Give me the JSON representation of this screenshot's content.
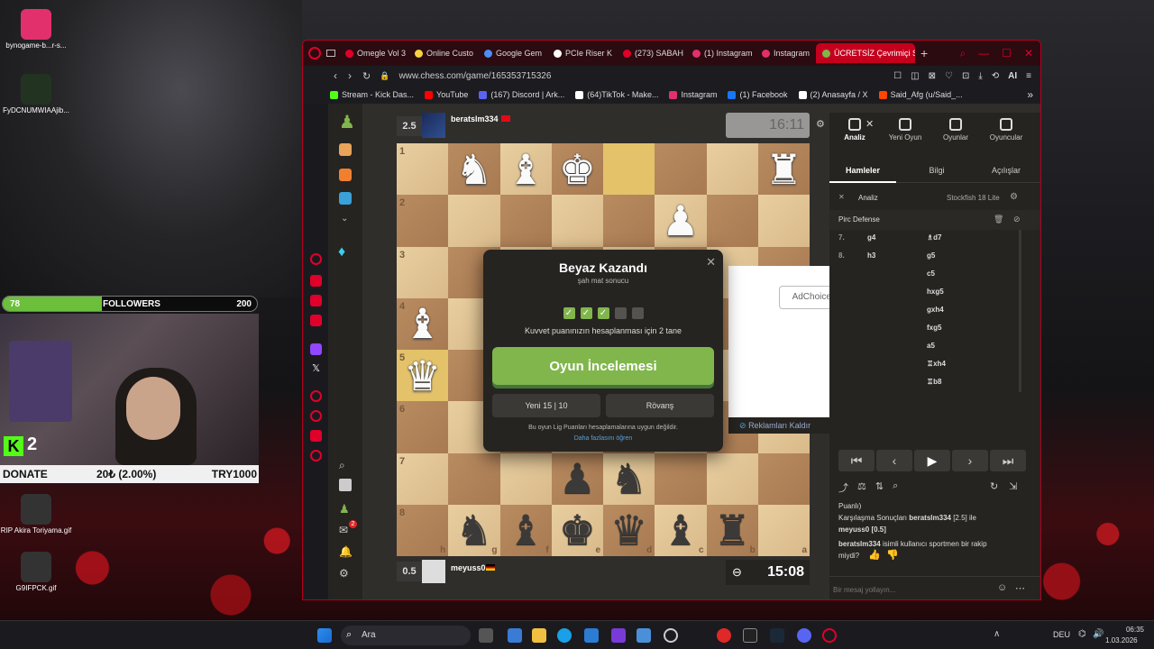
{
  "desktop": {
    "icons": [
      {
        "label": "bynogame-b...r-s...",
        "color": "#e1306c"
      },
      {
        "label": "FyDCNUMWIAAjib...",
        "color": "#223322"
      },
      {
        "label": "RIP Akira Toriyama.gif",
        "color": "#333333"
      },
      {
        "label": "G9IFPCK.gif",
        "color": "#333333"
      }
    ]
  },
  "overlay": {
    "followers_current": "78",
    "followers_label": "FOLLOWERS",
    "followers_goal": "200",
    "followers_progress": 0.39,
    "kick_count": "2",
    "donate_label": "DONATE",
    "donate_amount": "20₺ (2.00%)",
    "donate_goal": "TRY1000"
  },
  "browser": {
    "tabs": [
      {
        "label": "Omegle Vol 3",
        "color": "#e0002a"
      },
      {
        "label": "Online Custo",
        "color": "#f5d142"
      },
      {
        "label": "Google Gem",
        "color": "#4c8df6"
      },
      {
        "label": "PCIe Riser K",
        "color": "#ffffff"
      },
      {
        "label": "(273) SABAH",
        "color": "#e0002a"
      },
      {
        "label": "(1) Instagram",
        "color": "#e1306c"
      },
      {
        "label": "Instagram",
        "color": "#e1306c"
      },
      {
        "label": "ÜCRETSİZ Çevrimiçi Sa",
        "color": "#81b64c",
        "active": true
      }
    ],
    "url": "www.chess.com/game/165353715326",
    "ai_label": "AI",
    "bookmarks": [
      {
        "label": "Stream - Kick Das...",
        "color": "#53fc18"
      },
      {
        "label": "YouTube",
        "color": "#ff0000"
      },
      {
        "label": "(167) Discord | Ark...",
        "color": "#5865f2"
      },
      {
        "label": "(64)TikTok - Make...",
        "color": "#ffffff"
      },
      {
        "label": "Instagram",
        "color": "#e1306c"
      },
      {
        "label": "(1) Facebook",
        "color": "#1877f2"
      },
      {
        "label": "(2) Anasayfa / X",
        "color": "#ffffff"
      },
      {
        "label": "Said_Afg (u/Said_...",
        "color": "#ff4500"
      }
    ]
  },
  "game": {
    "top_player": {
      "score": "2.5",
      "name": "beratslm334",
      "clock": "16:11"
    },
    "bottom_player": {
      "score": "0.5",
      "name": "meyuss0",
      "clock": "15:08"
    },
    "ranks": [
      "1",
      "2",
      "3",
      "4",
      "5",
      "6",
      "7",
      "8"
    ],
    "files": [
      "h",
      "g",
      "f",
      "e",
      "d",
      "c",
      "b",
      "a"
    ],
    "pieces": [
      {
        "sq": [
          0,
          1
        ],
        "p": "♞",
        "c": "w"
      },
      {
        "sq": [
          0,
          2
        ],
        "p": "♝",
        "c": "w"
      },
      {
        "sq": [
          0,
          3
        ],
        "p": "♚",
        "c": "w"
      },
      {
        "sq": [
          0,
          7
        ],
        "p": "♜",
        "c": "w"
      },
      {
        "sq": [
          1,
          5
        ],
        "p": "♟",
        "c": "w"
      },
      {
        "sq": [
          3,
          0
        ],
        "p": "♝",
        "c": "w"
      },
      {
        "sq": [
          4,
          0
        ],
        "p": "♛",
        "c": "w"
      },
      {
        "sq": [
          6,
          3
        ],
        "p": "♟",
        "c": "b"
      },
      {
        "sq": [
          6,
          4
        ],
        "p": "♞",
        "c": "b"
      },
      {
        "sq": [
          7,
          1
        ],
        "p": "♞",
        "c": "b"
      },
      {
        "sq": [
          7,
          2
        ],
        "p": "♝",
        "c": "b"
      },
      {
        "sq": [
          7,
          3
        ],
        "p": "♚",
        "c": "b"
      },
      {
        "sq": [
          7,
          4
        ],
        "p": "♛",
        "c": "b"
      },
      {
        "sq": [
          7,
          5
        ],
        "p": "♝",
        "c": "b"
      },
      {
        "sq": [
          7,
          6
        ],
        "p": "♜",
        "c": "b"
      }
    ],
    "highlight": [
      [
        0,
        4
      ],
      [
        4,
        0
      ]
    ]
  },
  "modal": {
    "title": "Beyaz Kazandı",
    "subtitle": "şah mat sonucu",
    "strength_text": "Kuvvet puanınızın hesaplanması için 2 tane",
    "checks_done": 3,
    "checks_total": 5,
    "review_button": "Oyun İncelemesi",
    "new_game_button": "Yeni 15 | 10",
    "rematch_button": "Rövanş",
    "note": "Bu oyun Lig Puanları hesaplamalarına uygun değildir.",
    "learn_more": "Daha fazlasını öğren"
  },
  "ad": {
    "adchoices": "AdChoices",
    "remove_ads": "Reklamları Kaldır"
  },
  "panel": {
    "top_tabs": [
      "Analiz",
      "Yeni Oyun",
      "Oyunlar",
      "Oyuncular"
    ],
    "sub_tabs": [
      "Hamleler",
      "Bilgi",
      "Açılışlar"
    ],
    "analysis_label": "Analiz",
    "engine": "Stockfish 18 Lite",
    "opening": "Pirc Defense",
    "moves": [
      {
        "n": "7.",
        "w": "g4",
        "b": "♗d7"
      },
      {
        "n": "8.",
        "w": "h3",
        "b": "g5"
      },
      {
        "n": "",
        "w": "",
        "b": "c5"
      },
      {
        "n": "",
        "w": "",
        "b": "hxg5"
      },
      {
        "n": "",
        "w": "",
        "b": "gxh4"
      },
      {
        "n": "",
        "w": "",
        "b": "fxg5"
      },
      {
        "n": "",
        "w": "",
        "b": "a5"
      },
      {
        "n": "",
        "w": "",
        "b": "♖xh4"
      },
      {
        "n": "",
        "w": "",
        "b": "♖b8"
      }
    ],
    "chat": {
      "line1": "Puanlı)",
      "line2_prefix": "Karşılaşma Sonuçları",
      "line2_name": "beratslm334",
      "line2_mid": "[2.5] ile",
      "line3": "meyuss0 [0.5]",
      "line4_name": "beratslm334",
      "line4_rest": "isimli kullanıcı sportmen bir rakip",
      "line5": "miydi?",
      "placeholder": "Bir mesaj yollayın..."
    }
  },
  "taskbar": {
    "search": "Ara",
    "lang": "DEU",
    "time": "06:35",
    "date": "1.03.2026"
  }
}
